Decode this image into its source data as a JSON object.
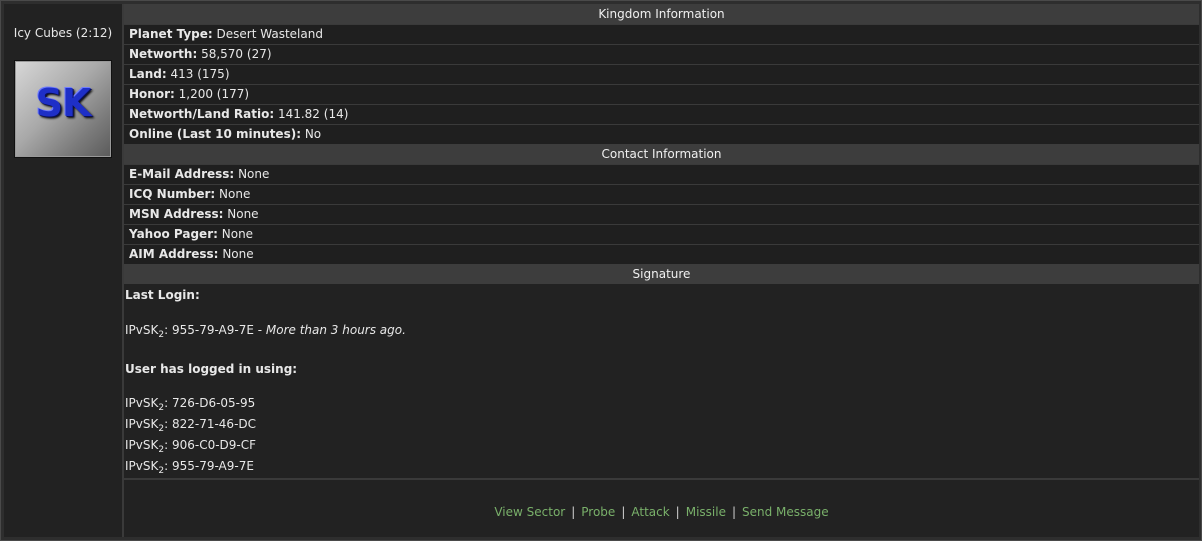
{
  "profile": {
    "name": "Icy Cubes (2:12)",
    "logo_text": "SK"
  },
  "kingdom": {
    "header": "Kingdom Information",
    "rows": [
      {
        "label": "Planet Type:",
        "value": "Desert Wasteland"
      },
      {
        "label": "Networth:",
        "value": "58,570 (27)"
      },
      {
        "label": "Land:",
        "value": "413 (175)"
      },
      {
        "label": "Honor:",
        "value": "1,200 (177)"
      },
      {
        "label": "Networth/Land Ratio:",
        "value": "141.82 (14)"
      },
      {
        "label": "Online (Last 10 minutes):",
        "value": "No"
      }
    ]
  },
  "contact": {
    "header": "Contact Information",
    "rows": [
      {
        "label": "E-Mail Address:",
        "value": "None"
      },
      {
        "label": "ICQ Number:",
        "value": "None"
      },
      {
        "label": "MSN Address:",
        "value": "None"
      },
      {
        "label": "Yahoo Pager:",
        "value": "None"
      },
      {
        "label": "AIM Address:",
        "value": "None"
      }
    ]
  },
  "signature": {
    "header": "Signature",
    "last_login_label": "Last Login:",
    "ip_prefix": "IPvSK",
    "ip_sub": "2",
    "last_login_ip": ": 955-79-A9-7E - ",
    "last_login_time": "More than 3 hours ago.",
    "logged_in_label": "User has logged in using:",
    "ips": [
      ": 726-D6-05-95",
      ": 822-71-46-DC",
      ": 906-C0-D9-CF",
      ": 955-79-A9-7E"
    ]
  },
  "actions": {
    "view_sector": "View Sector",
    "probe": "Probe",
    "attack": "Attack",
    "missile": "Missile",
    "send_message": "Send Message",
    "separator": "|"
  },
  "colors": {
    "link": "#79b06a",
    "header_bg": "#3d3d3d",
    "row_bg": "#1f1f1f"
  }
}
